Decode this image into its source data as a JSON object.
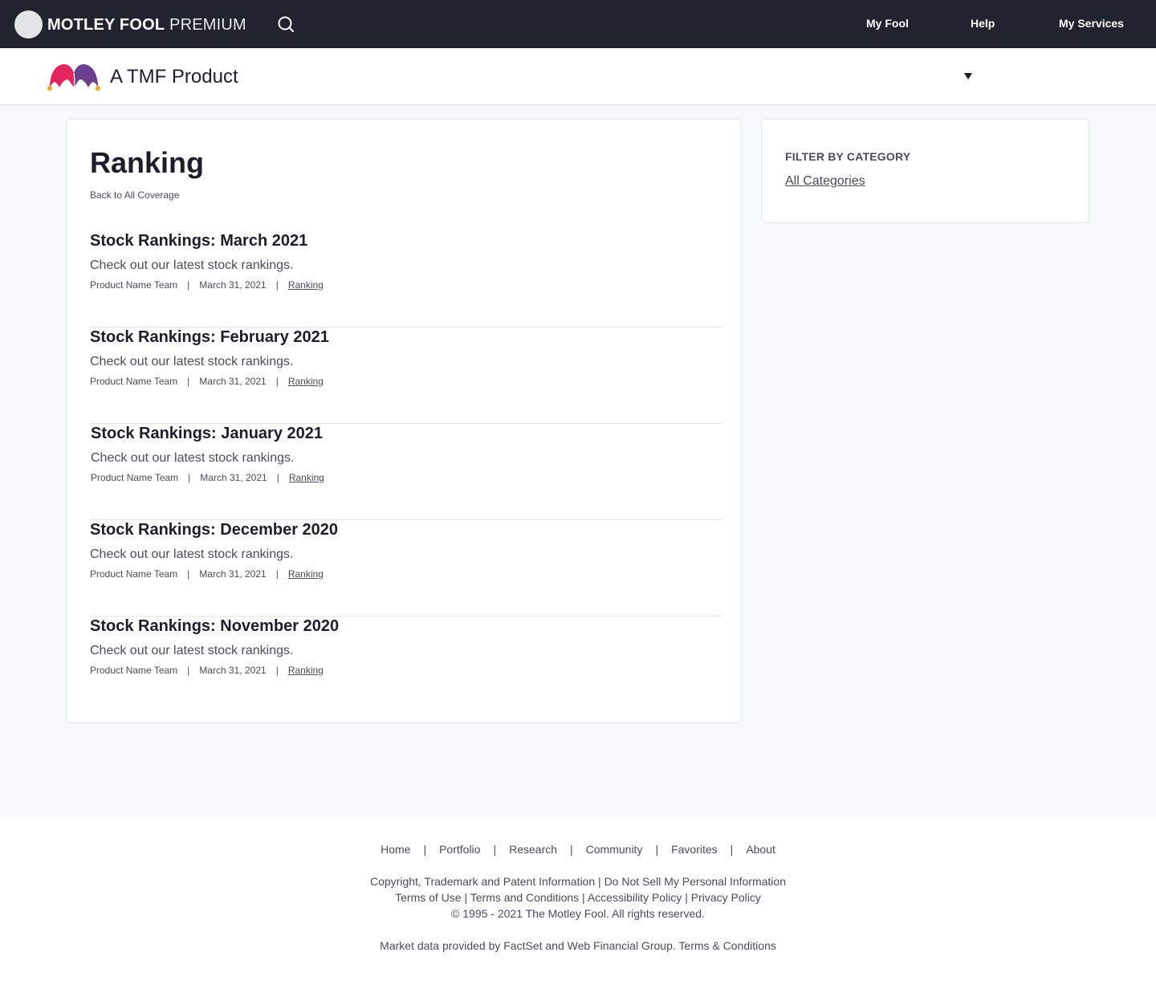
{
  "topbar": {
    "brand_bold": "MOTLEY FOOL",
    "brand_light": "PREMIUM",
    "nav": [
      "My Fool",
      "Help",
      "My Services"
    ]
  },
  "product": {
    "name": "A TMF Product"
  },
  "page": {
    "title": "Ranking",
    "back_link": "Back to All Coverage"
  },
  "articles": [
    {
      "title": "Stock Rankings: March 2021",
      "desc": "Check out our latest stock rankings.",
      "author": "Product Name Team",
      "date": "March 31, 2021",
      "category": "Ranking"
    },
    {
      "title": "Stock Rankings: February 2021",
      "desc": "Check out our latest stock rankings.",
      "author": "Product Name Team",
      "date": "March 31, 2021",
      "category": "Ranking"
    },
    {
      "title": "Stock Rankings: January 2021",
      "desc": "Check out our latest stock rankings.",
      "author": "Product Name Team",
      "date": "March 31, 2021",
      "category": "Ranking"
    },
    {
      "title": "Stock Rankings: December 2020",
      "desc": "Check out our latest stock rankings.",
      "author": "Product Name Team",
      "date": "March 31, 2021",
      "category": "Ranking"
    },
    {
      "title": "Stock Rankings: November 2020",
      "desc": "Check out our latest stock rankings.",
      "author": "Product Name Team",
      "date": "March 31, 2021",
      "category": "Ranking"
    }
  ],
  "meta_separator": "|",
  "sidebar": {
    "filter_heading": "FILTER BY CATEGORY",
    "filter_link": "All Categories"
  },
  "footer": {
    "nav": [
      "Home",
      "Portfolio",
      "Research",
      "Community",
      "Favorites",
      "About"
    ],
    "nav_separator": "|",
    "link_separator": " | ",
    "legal_line1": [
      "Copyright, Trademark and Patent Information",
      "Do Not Sell My Personal Information"
    ],
    "legal_line2": [
      "Terms of Use",
      "Terms and Conditions",
      "Accessibility Policy",
      "Privacy Policy"
    ],
    "copyright": "© 1995 - 2021 The Motley Fool. All rights reserved.",
    "market_data": "Market data provided by FactSet and Web Financial Group.",
    "market_terms": "Terms & Conditions"
  },
  "colors": {
    "topbar_bg": "#21232f",
    "logo_pink": "#e3255e",
    "logo_purple": "#6d3f8f",
    "logo_gold": "#f0a626",
    "text_primary": "#1c1e2b",
    "text_secondary": "#4a4c59"
  },
  "icons": [
    "avatar",
    "search-icon",
    "jester-logo-icon",
    "caret-down-icon"
  ]
}
